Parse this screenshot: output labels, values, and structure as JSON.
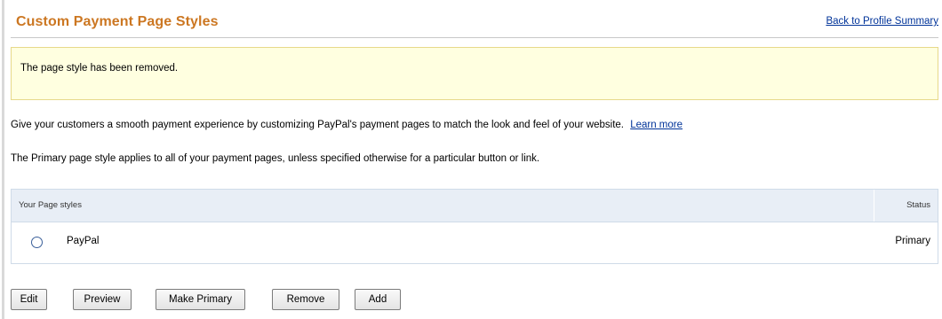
{
  "header": {
    "title": "Custom Payment Page Styles",
    "back_link": "Back to Profile Summary"
  },
  "notice": {
    "text": "The page style has been removed."
  },
  "intro": {
    "text": "Give your customers a smooth payment experience by customizing PayPal's payment pages to match the look and feel of your website.",
    "learn_more": "Learn more"
  },
  "primary_note": "The Primary page style applies to all of your payment pages, unless specified otherwise for a particular button or link.",
  "table": {
    "headers": {
      "name": "Your Page styles",
      "status": "Status"
    },
    "rows": [
      {
        "name": "PayPal",
        "status": "Primary",
        "selected": false
      }
    ]
  },
  "buttons": {
    "edit": "Edit",
    "preview": "Preview",
    "make_primary": "Make Primary",
    "remove": "Remove",
    "add": "Add"
  },
  "colors": {
    "title": "#cc7722",
    "link": "#003399",
    "notice_bg": "#ffffe0",
    "table_header_bg": "#e8eef6"
  }
}
